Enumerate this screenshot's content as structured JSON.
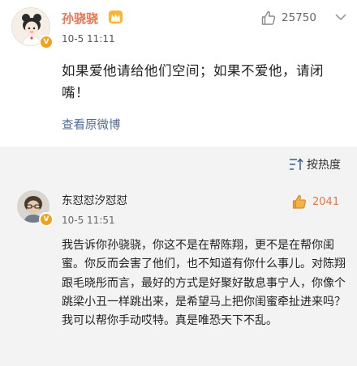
{
  "post": {
    "username": "孙骁骁",
    "timestamp": "10-5 11:11",
    "like_count": "25750",
    "content": "如果爱他请给他们空间；如果不爱他，请闭嘴！",
    "view_original_label": "查看原微博",
    "icons": {
      "like": "thumbs-up-icon",
      "more": "chevron-down-icon",
      "verified": "verified-badge-icon",
      "member": "member-crown-icon"
    }
  },
  "comments_section": {
    "sort_label": "按热度",
    "sort_icon": "sort-icon",
    "comments": [
      {
        "username": "东怼怼汐怼怼",
        "timestamp": "10-5 11:51",
        "like_count": "2041",
        "content": "我告诉你孙骁骁，你这不是在帮陈翔，更不是在帮你闺蜜。你反而会害了他们，也不知道有你什么事儿。对陈翔跟毛晓彤而言，最好的方式是好聚好散息事宁人，你像个跳梁小丑一样跳出来，是希望马上把你闺蜜牵扯进来吗？我可以帮你手动哎特。真是唯恐天下不乱。"
      }
    ]
  },
  "colors": {
    "username_accent": "#eb7350",
    "link": "#4e6a96",
    "like_active": "#e07a3e",
    "verified_badge": "#f2a11d",
    "comments_background": "#f3f3f3"
  }
}
